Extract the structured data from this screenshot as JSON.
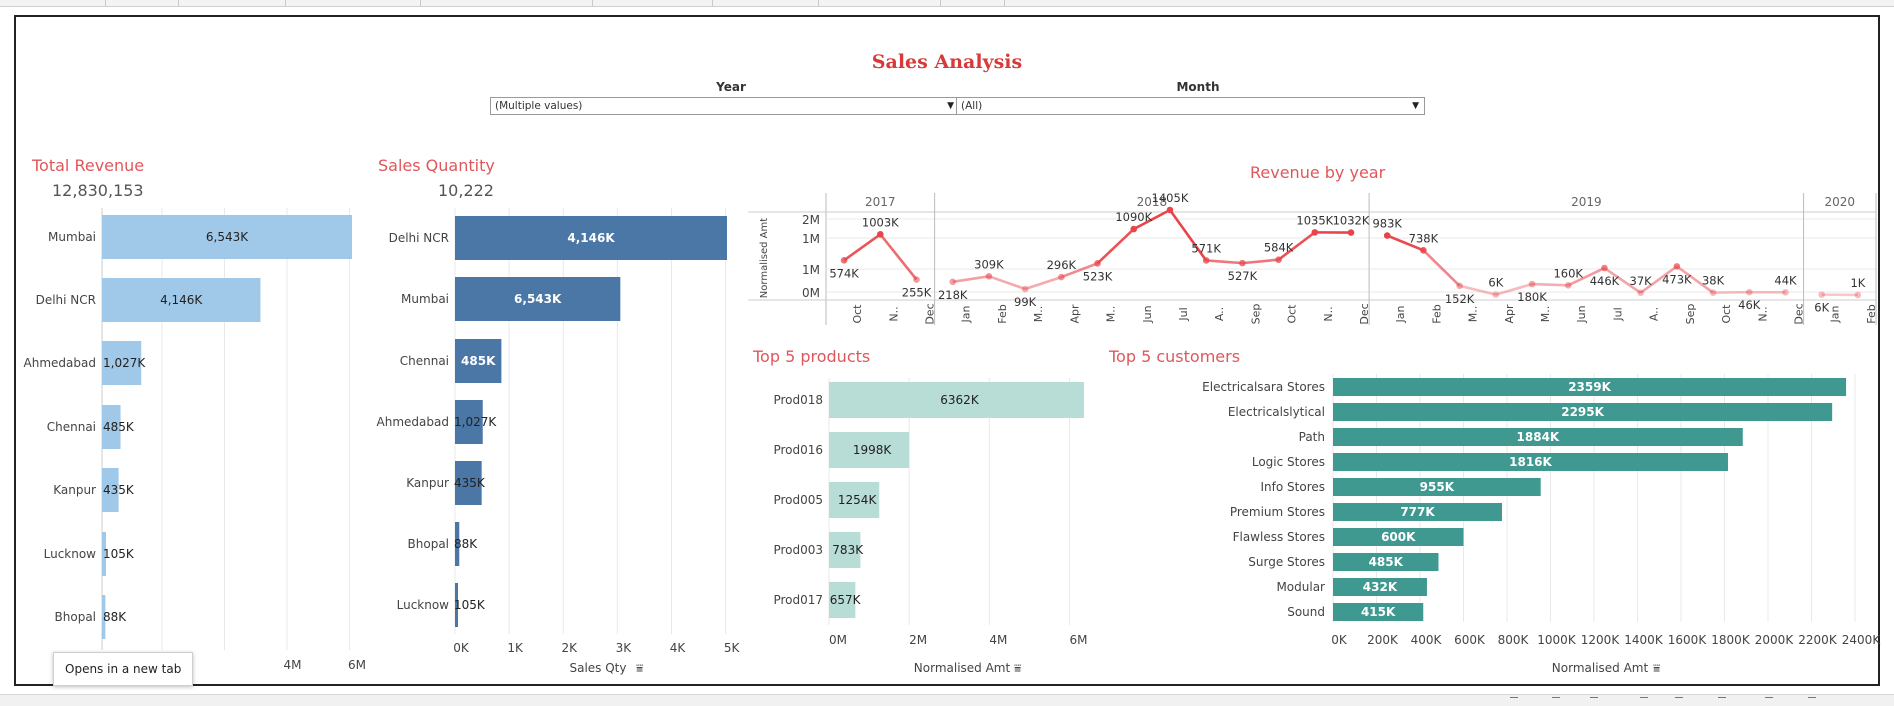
{
  "dashboard": {
    "title": "Sales Analysis",
    "filters": {
      "year": {
        "label": "Year",
        "value": "(Multiple values)"
      },
      "month": {
        "label": "Month",
        "value": "(All)"
      }
    },
    "tooltip": "Opens in a new tab"
  },
  "total_revenue": {
    "title": "Total Revenue",
    "kpi": "12,830,153",
    "x_ticks": [
      "4M",
      "6M"
    ],
    "chart_data": {
      "type": "bar",
      "orientation": "horizontal",
      "categories": [
        "Mumbai",
        "Delhi NCR",
        "Ahmedabad",
        "Chennai",
        "Kanpur",
        "Lucknow",
        "Bhopal"
      ],
      "values": [
        6543000,
        4146000,
        1027000,
        485000,
        435000,
        105000,
        88000
      ],
      "labels": [
        "6,543K",
        "4,146K",
        "1,027K",
        "485K",
        "435K",
        "105K",
        "88K"
      ],
      "xlim": [
        0,
        6543000
      ],
      "color": "#a0c8e8"
    }
  },
  "sales_quantity": {
    "title": "Sales Quantity",
    "kpi": "10,222",
    "x_ticks": [
      "0K",
      "1K",
      "2K",
      "3K",
      "4K",
      "5K"
    ],
    "x_axis_label": "Sales Qty",
    "chart_data": {
      "type": "bar",
      "orientation": "horizontal",
      "categories": [
        "Delhi NCR",
        "Mumbai",
        "Chennai",
        "Ahmedabad",
        "Kanpur",
        "Bhopal",
        "Lucknow"
      ],
      "values": [
        5100,
        3100,
        870,
        520,
        500,
        80,
        50
      ],
      "labels": [
        "4,146K",
        "6,543K",
        "485K",
        "1,027K",
        "435K",
        "88K",
        "105K"
      ],
      "xlim": [
        0,
        5100
      ],
      "color": "#4a77a6"
    }
  },
  "revenue_by_year": {
    "title": "Revenue by year",
    "y_axis_label": "Normalised Amt",
    "y_ticks": [
      "2M",
      "1M",
      "1M",
      "0M"
    ],
    "chart_data": {
      "type": "line",
      "years": [
        {
          "year": "2017",
          "months": [
            "Oct",
            "N..",
            "Dec"
          ],
          "values": [
            574,
            1003,
            255
          ],
          "labels": [
            "574K",
            "1003K",
            "255K"
          ]
        },
        {
          "year": "2018",
          "months": [
            "Jan",
            "Feb",
            "M..",
            "Apr",
            "M..",
            "Jun",
            "Jul",
            "A..",
            "Sep",
            "Oct",
            "N..",
            "Dec"
          ],
          "values": [
            218,
            309,
            99,
            296,
            523,
            1090,
            1405,
            571,
            527,
            584,
            1035,
            1032
          ],
          "labels": [
            "218K",
            "309K",
            "99K",
            "296K",
            "523K",
            "1090K",
            "1405K",
            "571K",
            "527K",
            "584K",
            "1035K",
            "1032K"
          ]
        },
        {
          "year": "2019",
          "months": [
            "Jan",
            "Feb",
            "M..",
            "Apr",
            "M..",
            "Jun",
            "Jul",
            "A..",
            "Sep",
            "Oct",
            "N..",
            "Dec"
          ],
          "values": [
            983,
            738,
            152,
            6,
            180,
            160,
            446,
            37,
            473,
            38,
            46,
            44
          ],
          "labels": [
            "983K",
            "738K",
            "152K",
            "6K",
            "180K",
            "160K",
            "446K",
            "37K",
            "473K",
            "38K",
            "46K",
            "44K"
          ]
        },
        {
          "year": "2020",
          "months": [
            "Jan",
            "Feb"
          ],
          "values": [
            6,
            1
          ],
          "labels": [
            "6K",
            "1K"
          ]
        }
      ],
      "ylim": [
        0,
        1405
      ],
      "color": "#e8444a"
    }
  },
  "top_products": {
    "title": "Top 5 products",
    "x_ticks": [
      "0M",
      "2M",
      "4M",
      "6M"
    ],
    "x_axis_label": "Normalised Amt",
    "chart_data": {
      "type": "bar",
      "orientation": "horizontal",
      "categories": [
        "Prod018",
        "Prod016",
        "Prod005",
        "Prod003",
        "Prod017"
      ],
      "values": [
        6362,
        1998,
        1254,
        783,
        657
      ],
      "labels": [
        "6362K",
        "1998K",
        "1254K",
        "783K",
        "657K"
      ],
      "xlim": [
        0,
        6362
      ],
      "color": "#b8dcd6"
    }
  },
  "top_customers": {
    "title": "Top 5 customers",
    "x_ticks": [
      "0K",
      "200K",
      "400K",
      "600K",
      "800K",
      "1000K",
      "1200K",
      "1400K",
      "1600K",
      "1800K",
      "2000K",
      "2200K",
      "2400K"
    ],
    "x_axis_label": "Normalised Amt",
    "chart_data": {
      "type": "bar",
      "orientation": "horizontal",
      "categories": [
        "Electricalsara Stores",
        "Electricalslytical",
        "Path",
        "Logic Stores",
        "Info Stores",
        "Premium Stores",
        "Flawless Stores",
        "Surge Stores",
        "Modular",
        "Sound"
      ],
      "values": [
        2359,
        2295,
        1884,
        1816,
        955,
        777,
        600,
        485,
        432,
        415
      ],
      "labels": [
        "2359K",
        "2295K",
        "1884K",
        "1816K",
        "955K",
        "777K",
        "600K",
        "485K",
        "432K",
        "415K"
      ],
      "xlim": [
        0,
        2400
      ],
      "color": "#3f9991"
    }
  }
}
